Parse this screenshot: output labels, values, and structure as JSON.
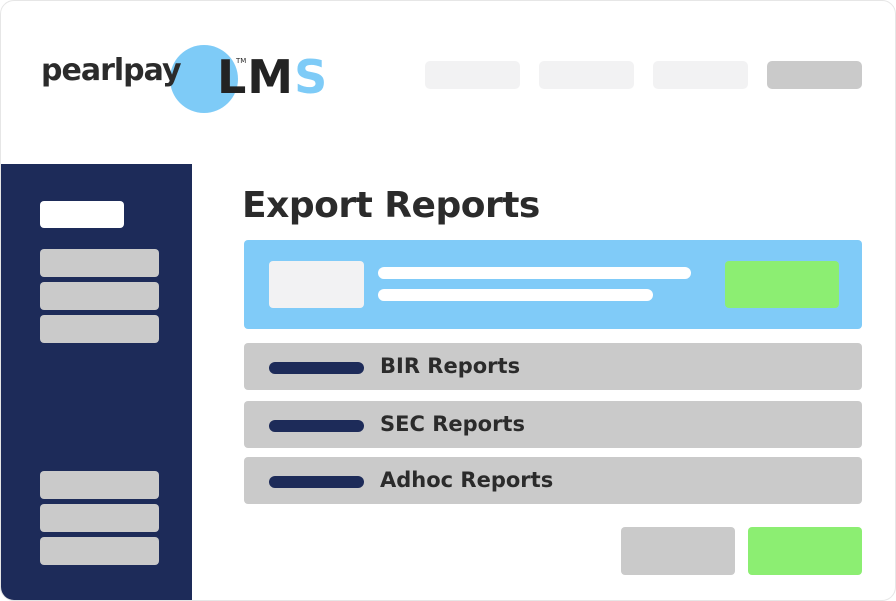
{
  "brand": {
    "name": "pearlpay",
    "trademark": "TM",
    "product_prefix": "LM",
    "product_suffix": "S",
    "colors": {
      "accent_blue": "#7ecbf7",
      "navy": "#1d2b59",
      "green": "#8cee72",
      "gray": "#cacaca"
    }
  },
  "topnav": {
    "items": [
      "",
      "",
      "",
      ""
    ]
  },
  "sidebar": {
    "items": [
      "",
      "",
      "",
      "",
      "",
      "",
      ""
    ]
  },
  "main": {
    "title": "Export Reports",
    "reports": [
      {
        "label": "BIR Reports"
      },
      {
        "label": "SEC Reports"
      },
      {
        "label": "Adhoc Reports"
      }
    ]
  }
}
